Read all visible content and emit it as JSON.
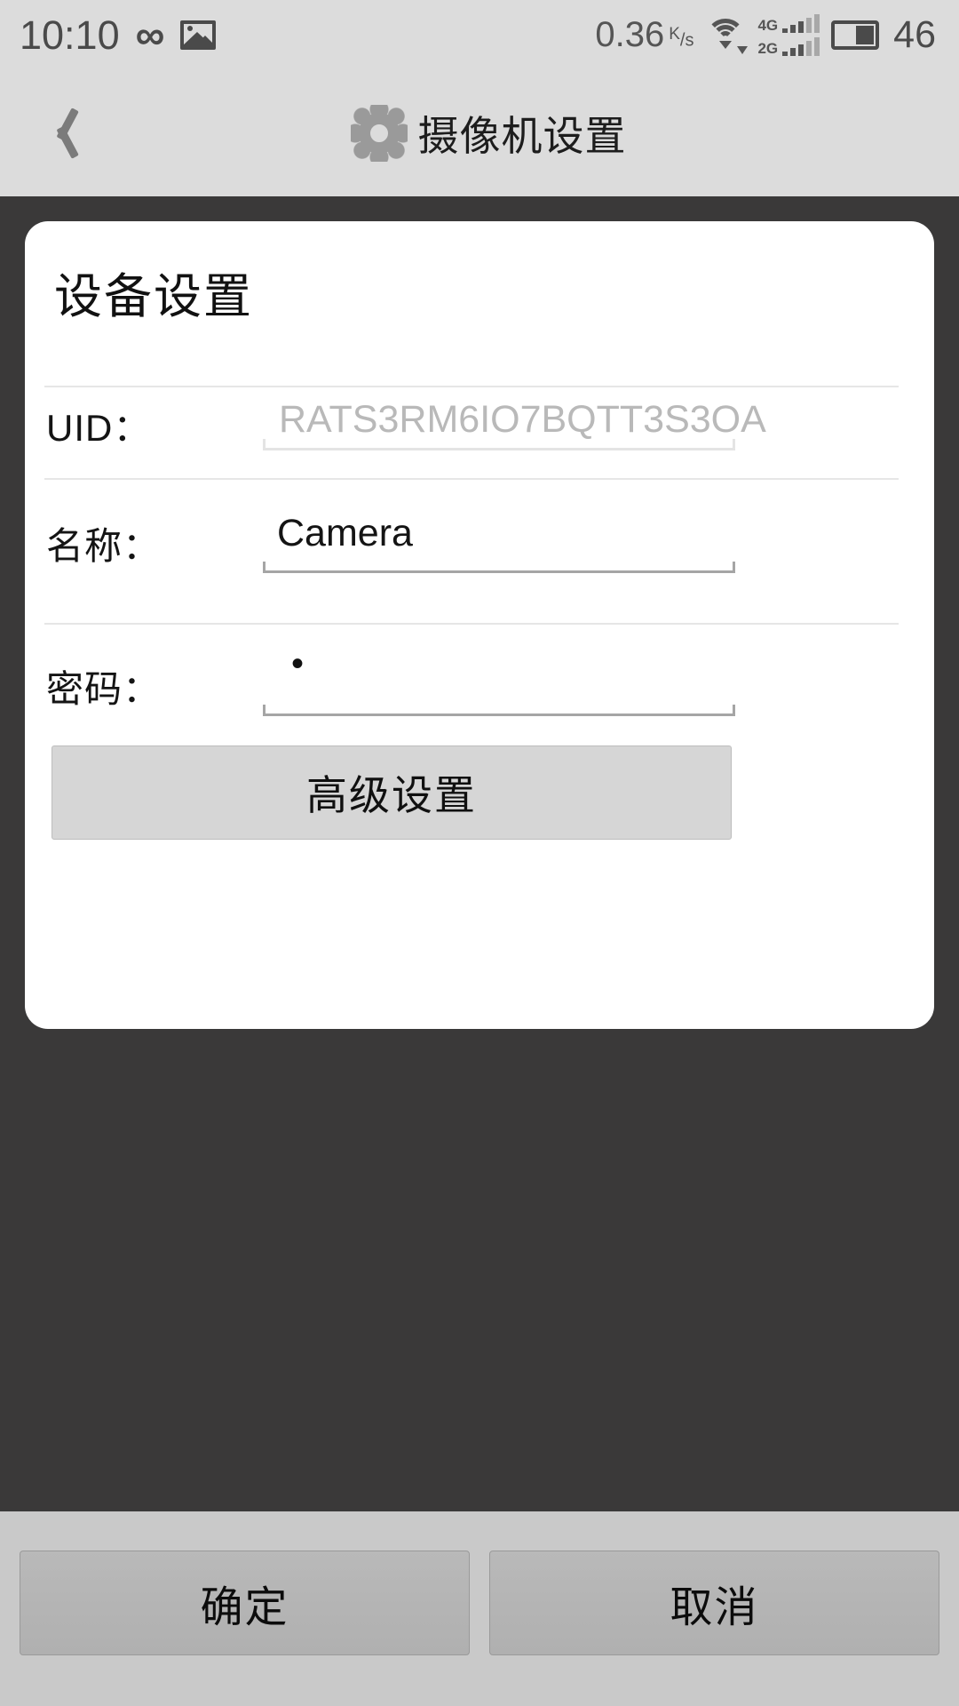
{
  "status_bar": {
    "time": "10:10",
    "infinity_icon": "infinity-icon",
    "gallery_icon": "gallery-icon",
    "network_speed": "0.36",
    "network_speed_unit_top": "K",
    "network_speed_unit_bottom": "s",
    "wifi_icon": "wifi-icon",
    "sim1_label": "4G",
    "sim2_label": "2G",
    "battery_icon": "battery-icon",
    "battery_level": "46"
  },
  "title_bar": {
    "back_icon": "back-chevron-icon",
    "gear_icon": "gear-icon",
    "title": "摄像机设置"
  },
  "card": {
    "title": "设备设置",
    "fields": [
      {
        "label": "UID：",
        "value": "RATS3RM6IO7BQTT3S3OA",
        "state": "disabled"
      },
      {
        "label": "名称：",
        "value": "Camera",
        "state": "active"
      },
      {
        "label": "密码：",
        "value": "•",
        "state": "active"
      }
    ],
    "advanced_button": "高级设置"
  },
  "bottom_bar": {
    "confirm_label": "确定",
    "cancel_label": "取消"
  },
  "colors": {
    "status_bg": "#dcdcdc",
    "title_bg": "#dcdcdc",
    "content_bg": "#3a3939",
    "card_bg": "#ffffff",
    "bottom_bg": "#c9c9c9",
    "button_bg": "#b4b4b4",
    "adv_button_bg": "#d6d6d6",
    "text_primary": "#111111",
    "text_muted": "#b9b9b9"
  }
}
